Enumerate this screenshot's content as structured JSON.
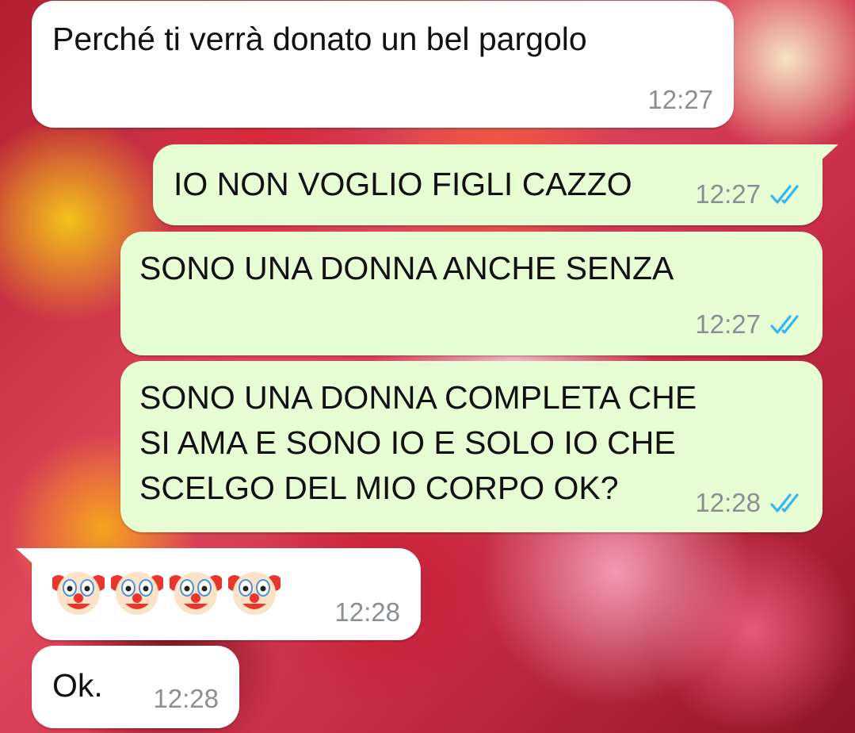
{
  "messages": [
    {
      "direction": "incoming",
      "text": "Perché ti verrà donato un bel pargolo",
      "time": "12:27"
    },
    {
      "direction": "outgoing",
      "text": "IO NON VOGLIO FIGLI CAZZO",
      "time": "12:27",
      "status": "read"
    },
    {
      "direction": "outgoing",
      "text": "SONO UNA DONNA ANCHE SENZA",
      "time": "12:27",
      "status": "read"
    },
    {
      "direction": "outgoing",
      "lines": [
        "SONO UNA DONNA COMPLETA CHE",
        "SI AMA E SONO IO E SOLO IO CHE",
        "SCELGO DEL MIO CORPO OK?"
      ],
      "time": "12:28",
      "status": "read"
    },
    {
      "direction": "incoming",
      "emoji": "clown-face",
      "emoji_count": 4,
      "time": "12:28"
    },
    {
      "direction": "incoming",
      "text": "Ok.",
      "time": "12:28"
    }
  ],
  "colors": {
    "incoming_bubble": "#ffffff",
    "outgoing_bubble": "#e7fdd3",
    "timestamp": "#8a8f93",
    "read_ticks": "#34b7f1"
  },
  "icons": {
    "read_receipt": "double-check-icon",
    "emoji": "clown-face-icon"
  }
}
